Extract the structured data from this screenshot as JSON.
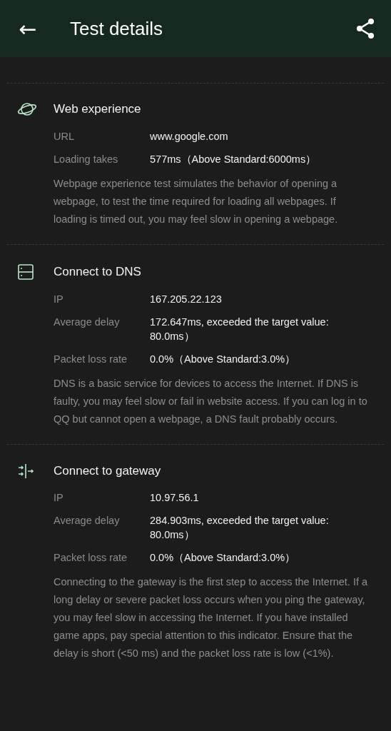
{
  "header": {
    "back": "←",
    "title": "Test details"
  },
  "sections": [
    {
      "kind": "web",
      "title": "Web experience",
      "rows": [
        {
          "label": "URL",
          "value": "www.google.com"
        },
        {
          "label": "Loading takes",
          "value": "577ms（Above Standard:6000ms）"
        }
      ],
      "description": "Webpage experience test simulates the behavior of opening a webpage, to test the time required for loading all webpages. If loading is timed out, you may feel slow in opening a webpage."
    },
    {
      "kind": "dns",
      "title": "Connect to DNS",
      "rows": [
        {
          "label": "IP",
          "value": "167.205.22.123"
        },
        {
          "label": "Average delay",
          "value": "172.647ms, exceeded the target value: 80.0ms）"
        },
        {
          "label": "Packet loss rate",
          "value": "0.0%（Above Standard:3.0%）"
        }
      ],
      "description": "DNS is a basic service for devices to access the Internet. If DNS is faulty, you may feel slow or fail in website access. If you can log in to QQ but cannot open a webpage, a DNS fault probably occurs."
    },
    {
      "kind": "gateway",
      "title": "Connect to gateway",
      "rows": [
        {
          "label": "IP",
          "value": "10.97.56.1"
        },
        {
          "label": "Average delay",
          "value": "284.903ms, exceeded the target value: 80.0ms）"
        },
        {
          "label": "Packet loss rate",
          "value": "0.0%（Above Standard:3.0%）"
        }
      ],
      "description": "Connecting to the gateway is the first step to access the Internet. If a long delay or severe packet loss occurs when you ping the gateway, you may feel slow in accessing the Internet. If you have installed game apps, pay special attention to this indicator. Ensure that the delay is short (<50 ms) and the packet loss rate is low (<1%)."
    }
  ]
}
